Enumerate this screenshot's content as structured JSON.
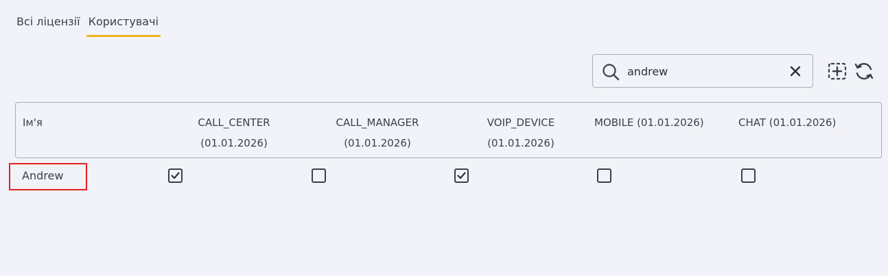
{
  "tabs": [
    {
      "label": "Всі ліцензії",
      "active": false
    },
    {
      "label": "Користувачі",
      "active": true
    }
  ],
  "colors": {
    "accent": "#f0b51a",
    "highlight_border": "#e02020",
    "background": "#f2f3f8",
    "text": "#3a3f4b"
  },
  "search": {
    "value": "andrew",
    "icon": "search-icon",
    "clear_icon": "close-icon"
  },
  "toolbar": {
    "columns_icon": "column-settings-icon",
    "refresh_icon": "refresh-icon"
  },
  "table": {
    "headers": {
      "name": "Ім'я",
      "call_center": {
        "line1": "CALL_CENTER",
        "line2": "(01.01.2026)"
      },
      "call_manager": {
        "line1": "CALL_MANAGER",
        "line2": "(01.01.2026)"
      },
      "voip_device": {
        "line1": "VOIP_DEVICE",
        "line2": "(01.01.2026)"
      },
      "mobile": "MOBILE (01.01.2026)",
      "chat": "CHAT (01.01.2026)"
    },
    "rows": [
      {
        "name": "Andrew",
        "call_center": true,
        "call_manager": false,
        "voip_device": true,
        "mobile": false,
        "chat": false
      }
    ]
  }
}
